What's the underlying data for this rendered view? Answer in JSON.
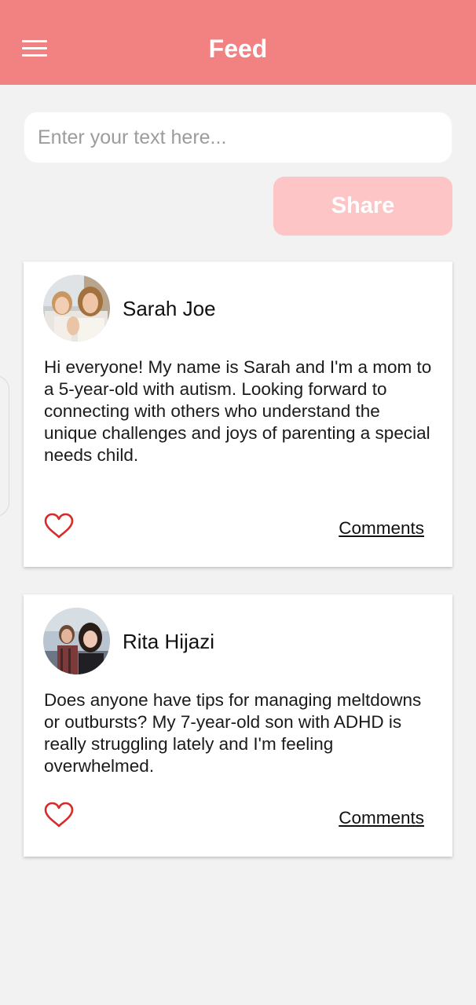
{
  "header": {
    "title": "Feed",
    "menu_icon": "hamburger-menu-icon",
    "background_color": "#f28181"
  },
  "composer": {
    "placeholder": "Enter your text here...",
    "value": ""
  },
  "share_button": {
    "label": "Share",
    "background_color": "#fdc5c5"
  },
  "posts": [
    {
      "author": "Sarah Joe",
      "avatar": "avatar-photo",
      "text": "Hi everyone! My name is Sarah and I'm a mom to a 5-year-old with autism. Looking forward to connecting with others who understand the unique challenges and joys of parenting a special needs child.",
      "like_icon": "heart-outline-icon",
      "comments_label": "Comments"
    },
    {
      "author": "Rita Hijazi",
      "avatar": "avatar-photo",
      "text": "Does anyone have tips for managing meltdowns or outbursts? My 7-year-old son with ADHD is really struggling lately and I'm feeling overwhelmed.",
      "like_icon": "heart-outline-icon",
      "comments_label": "Comments"
    }
  ],
  "colors": {
    "accent": "#f28181",
    "heart": "#d62b2b",
    "page_background": "#f1f2f1"
  }
}
